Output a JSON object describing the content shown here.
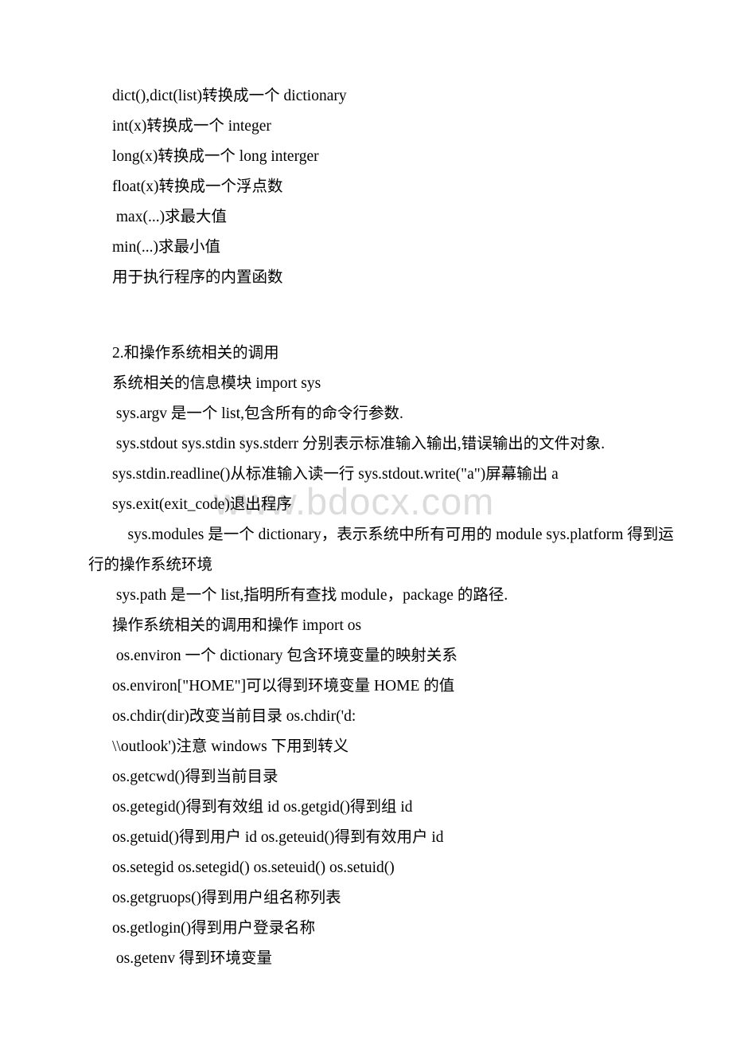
{
  "document": {
    "watermark": "www.bdocx.com",
    "blocks": [
      {
        "id": "builtin-conversion",
        "lines": [
          "dict(),dict(list)转换成一个 dictionary",
          "int(x)转换成一个 integer",
          "long(x)转换成一个 long interger",
          "float(x)转换成一个浮点数",
          " max(...)求最大值",
          "min(...)求最小值",
          "用于执行程序的内置函数"
        ]
      },
      {
        "id": "os-related-calls",
        "lines": [
          "2.和操作系统相关的调用",
          "系统相关的信息模块 import sys",
          " sys.argv 是一个 list,包含所有的命令行参数.",
          " sys.stdout sys.stdin sys.stderr 分别表示标准输入输出,错误输出的文件对象.",
          "sys.stdin.readline()从标准输入读一行 sys.stdout.write(\"a\")屏幕输出 a",
          "sys.exit(exit_code)退出程序"
        ]
      },
      {
        "id": "sys-modules-paragraph",
        "wrapped": {
          "first": "    sys.modules 是一个 dictionary，表示系统中所有可用的 module sys.platform 得到运",
          "second": "行的操作系统环境"
        }
      },
      {
        "id": "sys-path-and-os",
        "lines": [
          " sys.path 是一个 list,指明所有查找 module，package 的路径.",
          "操作系统相关的调用和操作 import os",
          " os.environ 一个 dictionary 包含环境变量的映射关系",
          "os.environ[\"HOME\"]可以得到环境变量 HOME 的值",
          "os.chdir(dir)改变当前目录 os.chdir('d:",
          "\\\\outlook')注意 windows 下用到转义",
          "os.getcwd()得到当前目录",
          "os.getegid()得到有效组 id os.getgid()得到组 id",
          "os.getuid()得到用户 id os.geteuid()得到有效用户 id",
          "os.setegid os.setegid() os.seteuid() os.setuid()",
          "os.getgruops()得到用户组名称列表",
          "os.getlogin()得到用户登录名称",
          " os.getenv 得到环境变量"
        ]
      }
    ]
  }
}
